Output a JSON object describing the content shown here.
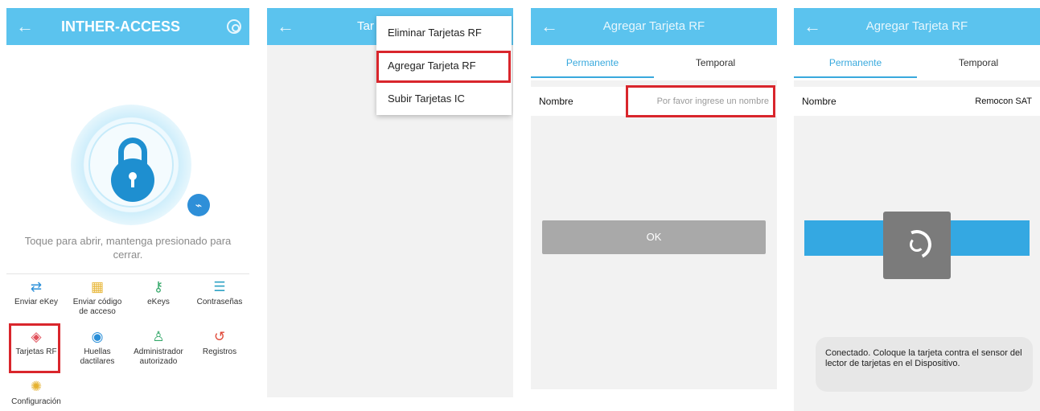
{
  "screen1": {
    "title": "INTHER-ACCESS",
    "hint": "Toque para abrir, mantenga presionado para cerrar.",
    "grid": [
      {
        "label": "Enviar eKey",
        "icon": "send-ekey-icon",
        "glyph": "⇄",
        "color": "#2a8fd8"
      },
      {
        "label": "Enviar código de acceso",
        "icon": "passcode-icon",
        "glyph": "▦",
        "color": "#e7b534"
      },
      {
        "label": "eKeys",
        "icon": "ekeys-icon",
        "glyph": "⚷",
        "color": "#35a86a"
      },
      {
        "label": "Contraseñas",
        "icon": "passwords-icon",
        "glyph": "☰",
        "color": "#2fa3c5"
      },
      {
        "label": "Tarjetas RF",
        "icon": "rf-card-icon",
        "glyph": "◈",
        "color": "#e0505a"
      },
      {
        "label": "Huellas dactilares",
        "icon": "fingerprint-icon",
        "glyph": "◉",
        "color": "#2a8fd8"
      },
      {
        "label": "Administrador autorizado",
        "icon": "admin-icon",
        "glyph": "♙",
        "color": "#35a86a"
      },
      {
        "label": "Registros",
        "icon": "records-icon",
        "glyph": "↺",
        "color": "#e04a3a"
      },
      {
        "label": "Configuración",
        "icon": "settings-icon",
        "glyph": "✺",
        "color": "#e5b12f"
      }
    ]
  },
  "screen2": {
    "title_fragment": "Tar",
    "menu": [
      "Eliminar Tarjetas RF",
      "Agregar Tarjeta RF",
      "Subir Tarjetas IC"
    ]
  },
  "screen3": {
    "title": "Agregar Tarjeta RF",
    "tabs": [
      "Permanente",
      "Temporal"
    ],
    "name_label": "Nombre",
    "name_placeholder": "Por favor ingrese un nombre",
    "ok_label": "OK"
  },
  "screen4": {
    "title": "Agregar Tarjeta RF",
    "tabs": [
      "Permanente",
      "Temporal"
    ],
    "name_label": "Nombre",
    "name_value": "Remocon SAT",
    "toast": "Conectado. Coloque la tarjeta contra el sensor del lector de tarjetas en el Dispositivo."
  }
}
